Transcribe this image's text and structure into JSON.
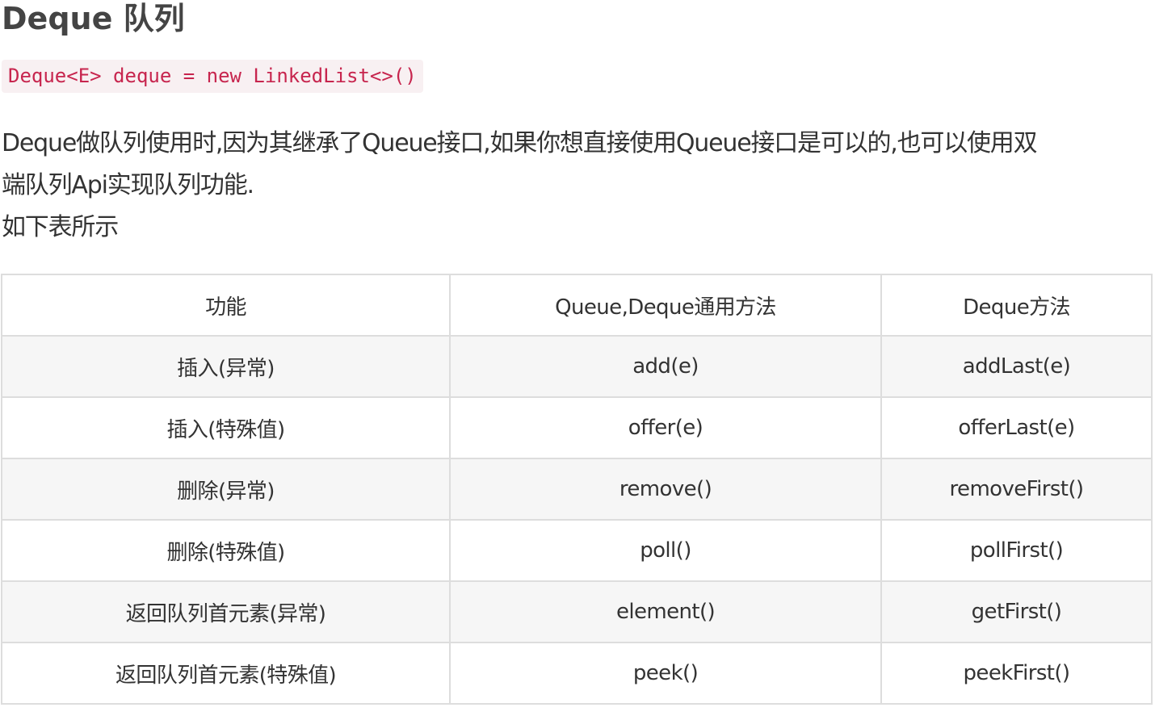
{
  "heading": "Deque 队列",
  "code": "Deque<E> deque = new LinkedList<>()",
  "paragraph": {
    "line1": "Deque做队列使用时,因为其继承了Queue接口,如果你想直接使用Queue接口是可以的,也可以使用双",
    "line2": "端队列Api实现队列功能.",
    "line3": "如下表所示"
  },
  "table": {
    "headers": [
      "功能",
      "Queue,Deque通用方法",
      "Deque方法"
    ],
    "rows": [
      [
        "插入(异常)",
        "add(e)",
        "addLast(e)"
      ],
      [
        "插入(特殊值)",
        "offer(e)",
        "offerLast(e)"
      ],
      [
        "删除(异常)",
        "remove()",
        "removeFirst()"
      ],
      [
        "删除(特殊值)",
        "poll()",
        "pollFirst()"
      ],
      [
        "返回队列首元素(异常)",
        "element()",
        "getFirst()"
      ],
      [
        "返回队列首元素(特殊值)",
        "peek()",
        "peekFirst()"
      ]
    ]
  }
}
